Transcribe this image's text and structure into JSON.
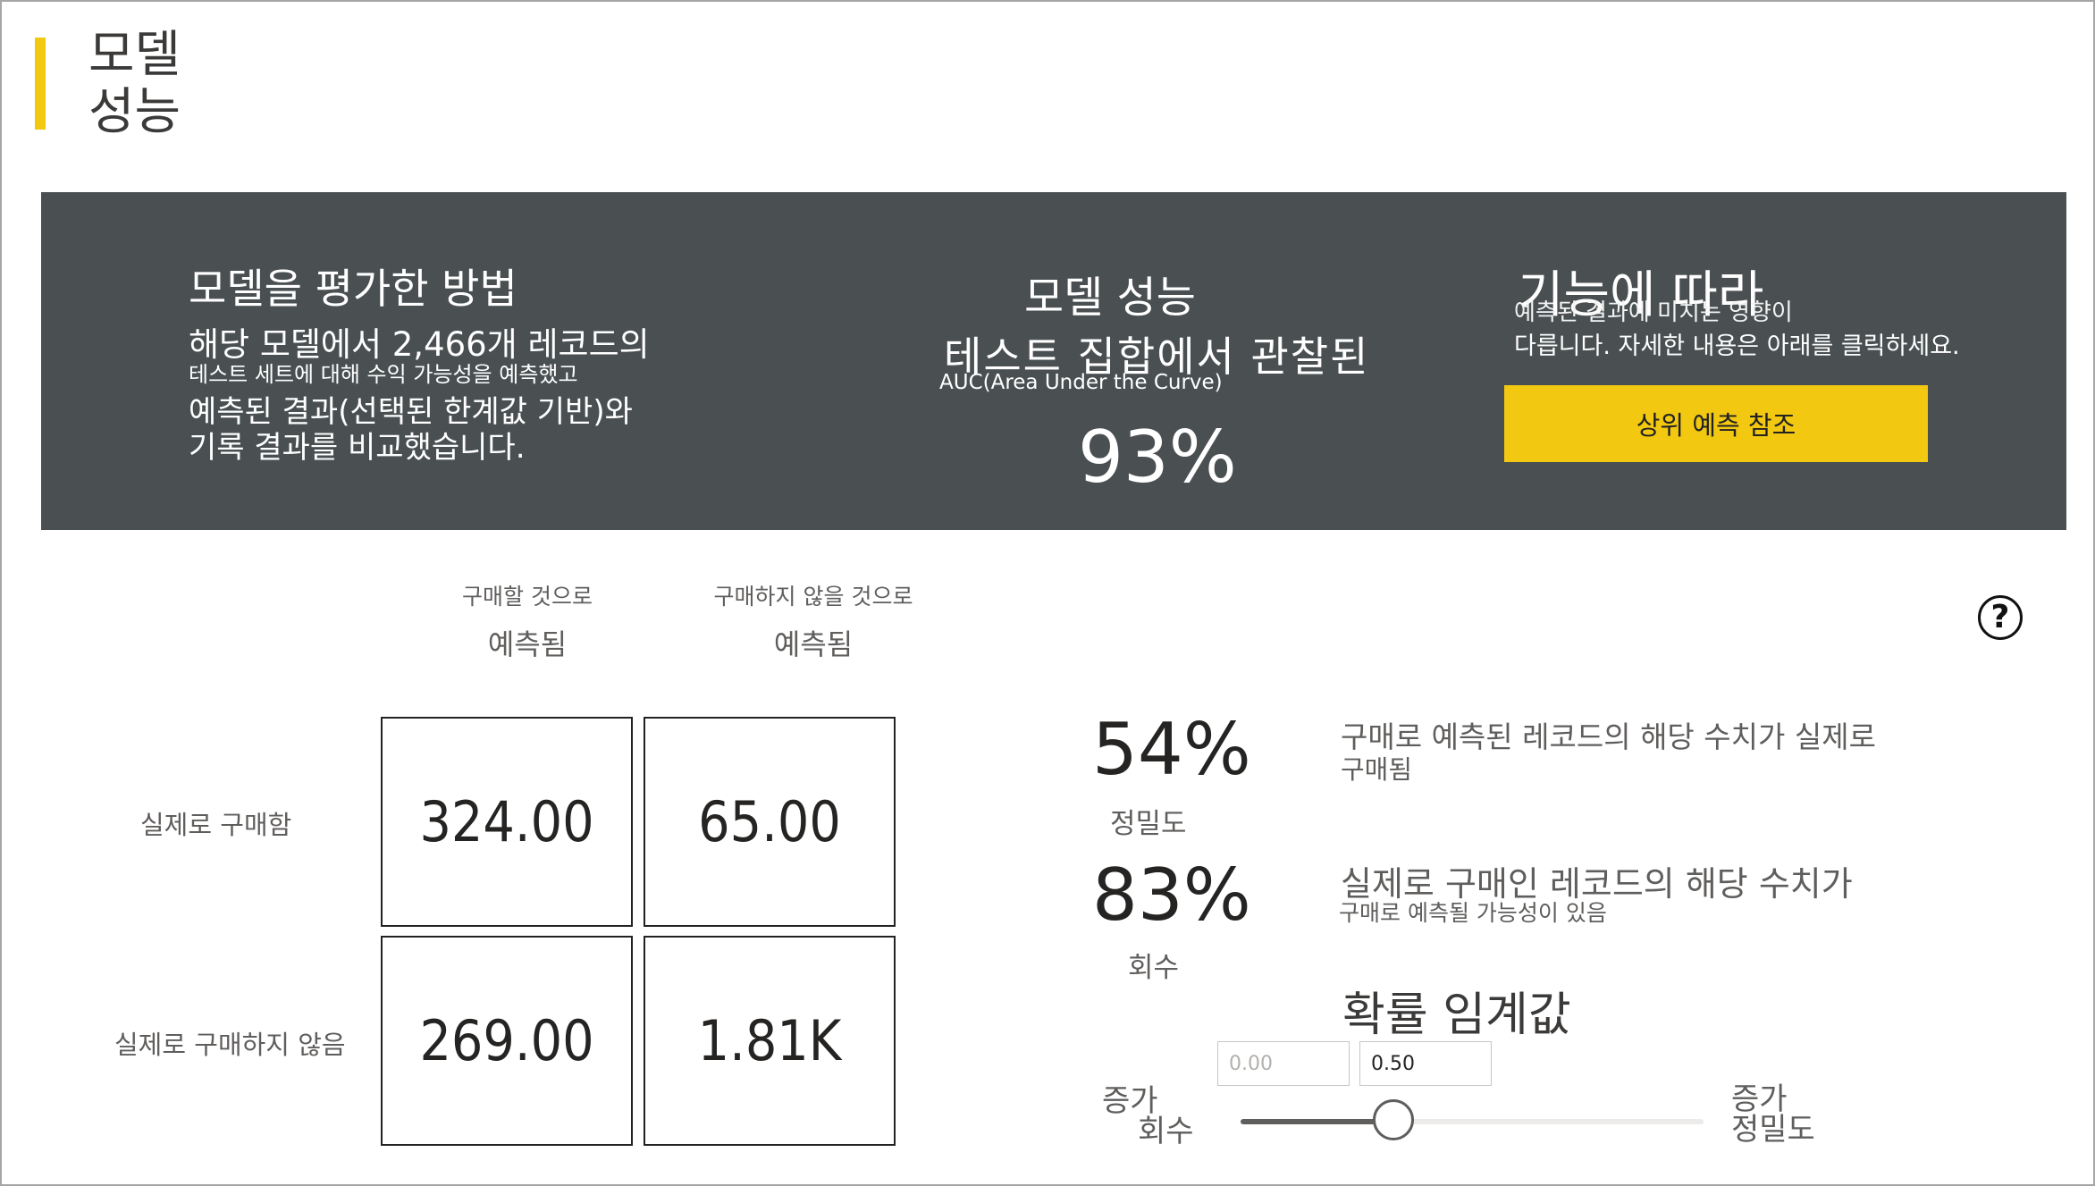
{
  "page": {
    "title_line1": "모델",
    "title_line2": "성능"
  },
  "banner": {
    "how_title": "모델을 평가한 방법",
    "how_line1": "해당 모델에서 2,466개 레코드의",
    "how_line2": "테스트 세트에 대해 수익 가능성을 예측했고",
    "how_line3": "예측된 결과(선택된 한계값 기반)와",
    "how_line4": "기록 결과를 비교했습니다.",
    "perf_title": "모델 성능",
    "perf_sub": "테스트 집합에서 관찰된",
    "perf_auc": "AUC(Area Under the Curve)",
    "perf_value": "93%",
    "feat_title": "기능에 따라",
    "feat_line1": "예측된 결과에 미치는 영향이",
    "feat_line2": "다릅니다. 자세한 내용은 아래를 클릭하세요.",
    "top_pred_button": "상위 예측 참조"
  },
  "matrix": {
    "col_headers": [
      {
        "small": "구매할 것으로",
        "big": "예측됨"
      },
      {
        "small": "구매하지 않을 것으로",
        "big": "예측됨"
      }
    ],
    "row_labels": [
      "실제로 구매함",
      "실제로 구매하지 않음"
    ],
    "cells": [
      [
        "324.00",
        "65.00"
      ],
      [
        "269.00",
        "1.81K"
      ]
    ]
  },
  "metrics": {
    "precision_value": "54%",
    "precision_label": "정밀도",
    "precision_desc_line1": "구매로 예측된 레코드의 해당 수치가 실제로",
    "precision_desc_line2": "구매됨",
    "recall_value": "83%",
    "recall_label": "회수",
    "recall_desc_line1": "실제로 구매인 레코드의 해당 수치가",
    "recall_desc_line2": "구매로 예측될 가능성이 있음"
  },
  "threshold": {
    "title": "확률 임계값",
    "min_value": "0.00",
    "current_value": "0.50",
    "slider_fraction": 0.33,
    "left_label_line1": "증가",
    "left_label_line2": "회수",
    "right_label_line1": "증가",
    "right_label_line2": "정밀도"
  },
  "colors": {
    "accent": "#f2c811",
    "banner_bg": "#4a5052"
  },
  "icons": {
    "help": "help-circle-icon"
  }
}
